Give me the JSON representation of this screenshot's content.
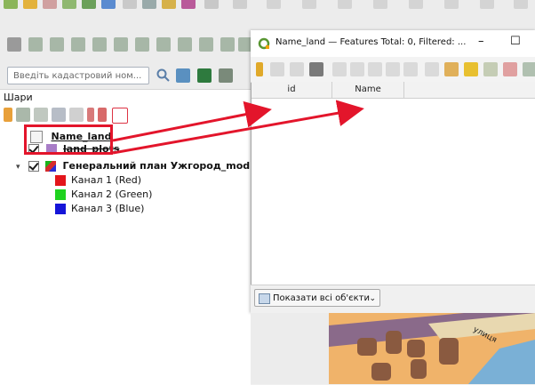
{
  "search": {
    "placeholder": "Введіть кадастровий ном..."
  },
  "layers_panel": {
    "title": "Шари",
    "tree": [
      {
        "label": "Name_land",
        "checked": false,
        "bold": true,
        "underline": true
      },
      {
        "label": "land_plots",
        "checked": true,
        "bold": true,
        "strike": true
      },
      {
        "label": "Генеральний план Ужгород_modifi",
        "checked": true,
        "bold": true
      },
      {
        "label": "Канал 1 (Red)",
        "color": "#e3151b"
      },
      {
        "label": "Канал 2 (Green)",
        "color": "#1fd21f"
      },
      {
        "label": "Канал 3 (Blue)",
        "color": "#1515d8"
      }
    ]
  },
  "attribute_window": {
    "title": "Name_land — Features Total: 0, Filtered: ...",
    "minimize": "–",
    "maximize": "☐",
    "columns": [
      "id",
      "Name"
    ],
    "show_all_button": "Показати всі об'єкти"
  },
  "colors": {
    "annotation_red": "#e3152b",
    "qgis_green": "#589632"
  },
  "map_label": "улиця"
}
